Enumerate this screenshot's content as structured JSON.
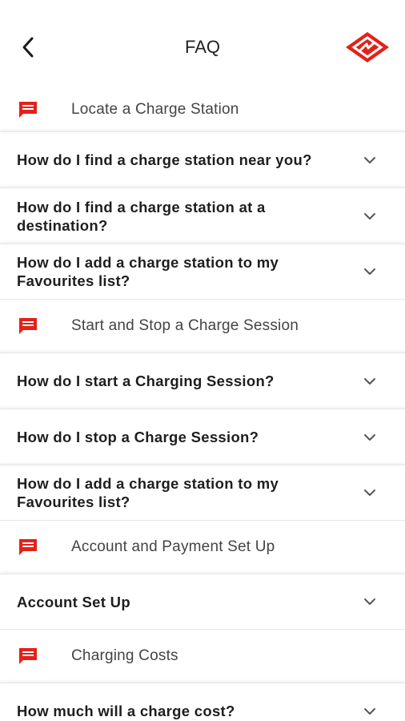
{
  "header": {
    "title": "FAQ",
    "back_icon": "chevron-left-icon",
    "logo_icon": "brand-logo-icon",
    "accent_color": "#e32119"
  },
  "sections": [
    {
      "label": "Locate a Charge Station",
      "icon": "chat-icon",
      "questions": [
        "How do I find a charge station near you?",
        "How do I find a charge station at a destination?",
        "How do I add a charge station to my Favourites list?"
      ]
    },
    {
      "label": "Start and Stop a Charge Session",
      "icon": "chat-icon",
      "questions": [
        "How do I start a Charging Session?",
        "How do I stop a Charge Session?",
        "How do I add a charge station to my Favourites list?"
      ]
    },
    {
      "label": "Account and Payment Set Up",
      "icon": "chat-icon",
      "questions": [
        "Account Set Up"
      ]
    },
    {
      "label": "Charging Costs",
      "icon": "chat-icon",
      "questions": [
        "How much will a charge cost?"
      ]
    }
  ]
}
